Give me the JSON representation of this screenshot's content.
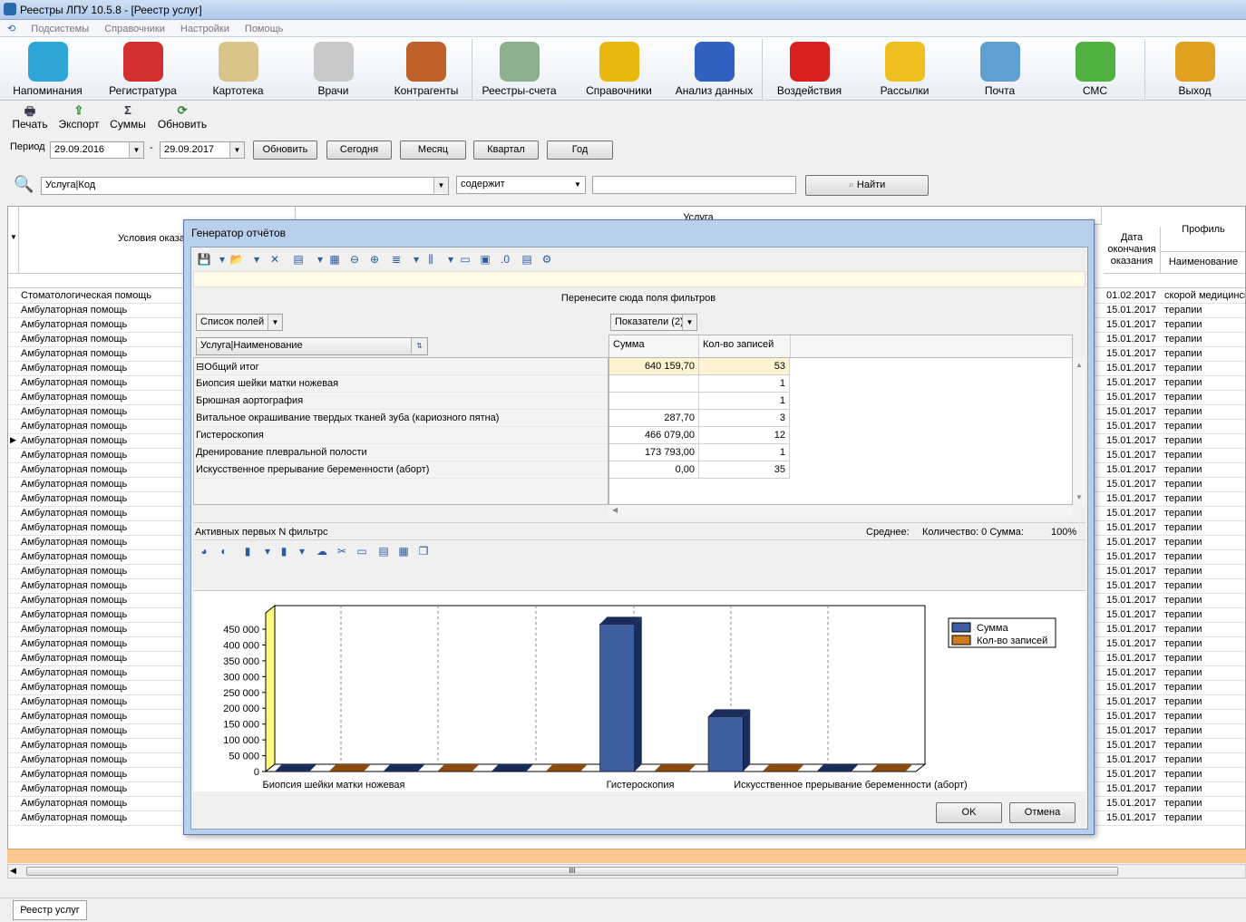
{
  "window": {
    "title": "Реестры ЛПУ 10.5.8 - [Реестр услуг]"
  },
  "menu": [
    "Подсистемы",
    "Справочники",
    "Настройки",
    "Помощь"
  ],
  "ribbon": [
    {
      "label": "Напоминания",
      "icon": "alarm-clock-icon",
      "color": "#2fa7d6"
    },
    {
      "label": "Регистратура",
      "icon": "receptionist-icon",
      "color": "#d23030"
    },
    {
      "label": "Картотека",
      "icon": "card-file-icon",
      "color": "#d9c48a"
    },
    {
      "label": "Врачи",
      "icon": "doctor-icon",
      "color": "#c9c9c9"
    },
    {
      "label": "Контрагенты",
      "icon": "people-icon",
      "color": "#c0602a"
    },
    {
      "label": "Реестры-счета",
      "icon": "registry-icon",
      "color": "#8fb08f"
    },
    {
      "label": "Справочники",
      "icon": "book-icon",
      "color": "#e8b810"
    },
    {
      "label": "Анализ данных",
      "icon": "cube-icon",
      "color": "#3060c0"
    },
    {
      "label": "Воздействия",
      "icon": "sale-tag-icon",
      "color": "#d82020"
    },
    {
      "label": "Рассылки",
      "icon": "envelope-icon",
      "color": "#f0c020"
    },
    {
      "label": "Почта",
      "icon": "mail-icon",
      "color": "#60a0d0"
    },
    {
      "label": "СМС",
      "icon": "sms-icon",
      "color": "#50b040"
    },
    {
      "label": "Выход",
      "icon": "exit-door-icon",
      "color": "#e0a020"
    }
  ],
  "toolbar": {
    "print": "Печать",
    "export": "Экспорт",
    "sums": "Суммы",
    "refresh": "Обновить"
  },
  "period": {
    "label": "Период",
    "from": "29.09.2016",
    "to": "29.09.2017",
    "dash": "-",
    "buttons": [
      "Обновить",
      "Сегодня",
      "Месяц",
      "Квартал",
      "Год"
    ]
  },
  "search": {
    "field": "Услуга|Код",
    "op": "содержит",
    "value": "",
    "button": "Найти"
  },
  "grid": {
    "col_conditions": "Условия оказани",
    "col_service": "Услуга",
    "col_end_date": "Дата окончания оказания",
    "col_profile": "Профиль",
    "col_profile_sub": "Наименование",
    "rows": [
      {
        "cond": "Стоматологическая помощь",
        "date": "01.02.2017",
        "profile": "скорой медицинской"
      },
      {
        "cond": "Амбулаторная помощь",
        "date": "15.01.2017",
        "profile": "терапии"
      },
      {
        "cond": "Амбулаторная помощь",
        "date": "15.01.2017",
        "profile": "терапии"
      },
      {
        "cond": "Амбулаторная помощь",
        "date": "15.01.2017",
        "profile": "терапии"
      },
      {
        "cond": "Амбулаторная помощь",
        "date": "15.01.2017",
        "profile": "терапии"
      },
      {
        "cond": "Амбулаторная помощь",
        "date": "15.01.2017",
        "profile": "терапии"
      },
      {
        "cond": "Амбулаторная помощь",
        "date": "15.01.2017",
        "profile": "терапии"
      },
      {
        "cond": "Амбулаторная помощь",
        "date": "15.01.2017",
        "profile": "терапии"
      },
      {
        "cond": "Амбулаторная помощь",
        "date": "15.01.2017",
        "profile": "терапии"
      },
      {
        "cond": "Амбулаторная помощь",
        "date": "15.01.2017",
        "profile": "терапии"
      },
      {
        "cond": "Амбулаторная помощь",
        "date": "15.01.2017",
        "profile": "терапии"
      },
      {
        "cond": "Амбулаторная помощь",
        "date": "15.01.2017",
        "profile": "терапии"
      },
      {
        "cond": "Амбулаторная помощь",
        "date": "15.01.2017",
        "profile": "терапии"
      },
      {
        "cond": "Амбулаторная помощь",
        "date": "15.01.2017",
        "profile": "терапии"
      },
      {
        "cond": "Амбулаторная помощь",
        "date": "15.01.2017",
        "profile": "терапии"
      },
      {
        "cond": "Амбулаторная помощь",
        "date": "15.01.2017",
        "profile": "терапии"
      },
      {
        "cond": "Амбулаторная помощь",
        "date": "15.01.2017",
        "profile": "терапии"
      },
      {
        "cond": "Амбулаторная помощь",
        "date": "15.01.2017",
        "profile": "терапии"
      },
      {
        "cond": "Амбулаторная помощь",
        "date": "15.01.2017",
        "profile": "терапии"
      },
      {
        "cond": "Амбулаторная помощь",
        "date": "15.01.2017",
        "profile": "терапии"
      },
      {
        "cond": "Амбулаторная помощь",
        "date": "15.01.2017",
        "profile": "терапии"
      },
      {
        "cond": "Амбулаторная помощь",
        "date": "15.01.2017",
        "profile": "терапии"
      },
      {
        "cond": "Амбулаторная помощь",
        "date": "15.01.2017",
        "profile": "терапии"
      },
      {
        "cond": "Амбулаторная помощь",
        "date": "15.01.2017",
        "profile": "терапии"
      },
      {
        "cond": "Амбулаторная помощь",
        "date": "15.01.2017",
        "profile": "терапии"
      },
      {
        "cond": "Амбулаторная помощь",
        "date": "15.01.2017",
        "profile": "терапии"
      },
      {
        "cond": "Амбулаторная помощь",
        "date": "15.01.2017",
        "profile": "терапии"
      },
      {
        "cond": "Амбулаторная помощь",
        "date": "15.01.2017",
        "profile": "терапии"
      },
      {
        "cond": "Амбулаторная помощь",
        "date": "15.01.2017",
        "profile": "терапии"
      },
      {
        "cond": "Амбулаторная помощь",
        "date": "15.01.2017",
        "profile": "терапии"
      },
      {
        "cond": "Амбулаторная помощь",
        "date": "15.01.2017",
        "profile": "терапии"
      },
      {
        "cond": "Амбулаторная помощь",
        "date": "15.01.2017",
        "profile": "терапии"
      },
      {
        "cond": "Амбулаторная помощь",
        "date": "15.01.2017",
        "profile": "терапии"
      },
      {
        "cond": "Амбулаторная помощь",
        "date": "15.01.2017",
        "profile": "терапии"
      },
      {
        "cond": "Амбулаторная помощь",
        "date": "15.01.2017",
        "profile": "терапии"
      },
      {
        "cond": "Амбулаторная помощь",
        "date": "15.01.2017",
        "profile": "терапии"
      },
      {
        "cond": "Амбулаторная помощь",
        "date": "15.01.2017",
        "profile": "терапии"
      }
    ],
    "hscroll_grip": "III"
  },
  "tabs": [
    "Реестр услуг"
  ],
  "dialog": {
    "title": "Генератор отчётов",
    "filter_hint": "Перенесите сюда поля фильтров",
    "fields_list": "Список полей",
    "indicators": "Показатели (2)",
    "row_field": "Услуга|Наименование",
    "col_sum": "Сумма",
    "col_count": "Кол-во записей",
    "rows": [
      {
        "name": "Общий итог",
        "sum": "640 159,70",
        "count": "53",
        "total": true
      },
      {
        "name": "Биопсия шейки матки ножевая",
        "sum": "",
        "count": "1"
      },
      {
        "name": "Брюшная аортография",
        "sum": "",
        "count": "1"
      },
      {
        "name": "Витальное окрашивание твердых тканей зуба (кариозного пятна)",
        "sum": "287,70",
        "count": "3"
      },
      {
        "name": "Гистероскопия",
        "sum": "466 079,00",
        "count": "12"
      },
      {
        "name": "Дренирование плевральной полости",
        "sum": "173 793,00",
        "count": "1"
      },
      {
        "name": "Искусственное прерывание беременности (аборт)",
        "sum": "0,00",
        "count": "35"
      }
    ],
    "status": {
      "active": "Активных первых N фильтрс",
      "avg": "Среднее:",
      "qty": "Количество: 0  Сумма:",
      "zoom": "100%"
    },
    "ok": "OK",
    "cancel": "Отмена"
  },
  "chart_data": {
    "type": "bar",
    "categories": [
      "Биопсия шейки матки ножевая",
      "Брюшная аортография",
      "Витальное окрашивание твердых тканей зуба (кариозного пятна)",
      "Гистероскопия",
      "Дренирование плевральной полости",
      "Искусственное прерывание беременности (аборт)"
    ],
    "category_labels_shown": [
      "Биопсия шейки матки ножевая",
      "Гистероскопия",
      "Искусственное прерывание беременности (аборт)"
    ],
    "series": [
      {
        "name": "Сумма",
        "color": "#3f5fa0",
        "values": [
          0,
          0,
          287.7,
          466079,
          173793,
          0
        ]
      },
      {
        "name": "Кол-во записей",
        "color": "#d07a20",
        "values": [
          1,
          1,
          3,
          12,
          1,
          35
        ]
      }
    ],
    "ylim": [
      0,
      450000
    ],
    "yticks": [
      "0",
      "50 000",
      "100 000",
      "150 000",
      "200 000",
      "250 000",
      "300 000",
      "350 000",
      "400 000",
      "450 000"
    ],
    "grid": true,
    "legend": "top-right"
  }
}
